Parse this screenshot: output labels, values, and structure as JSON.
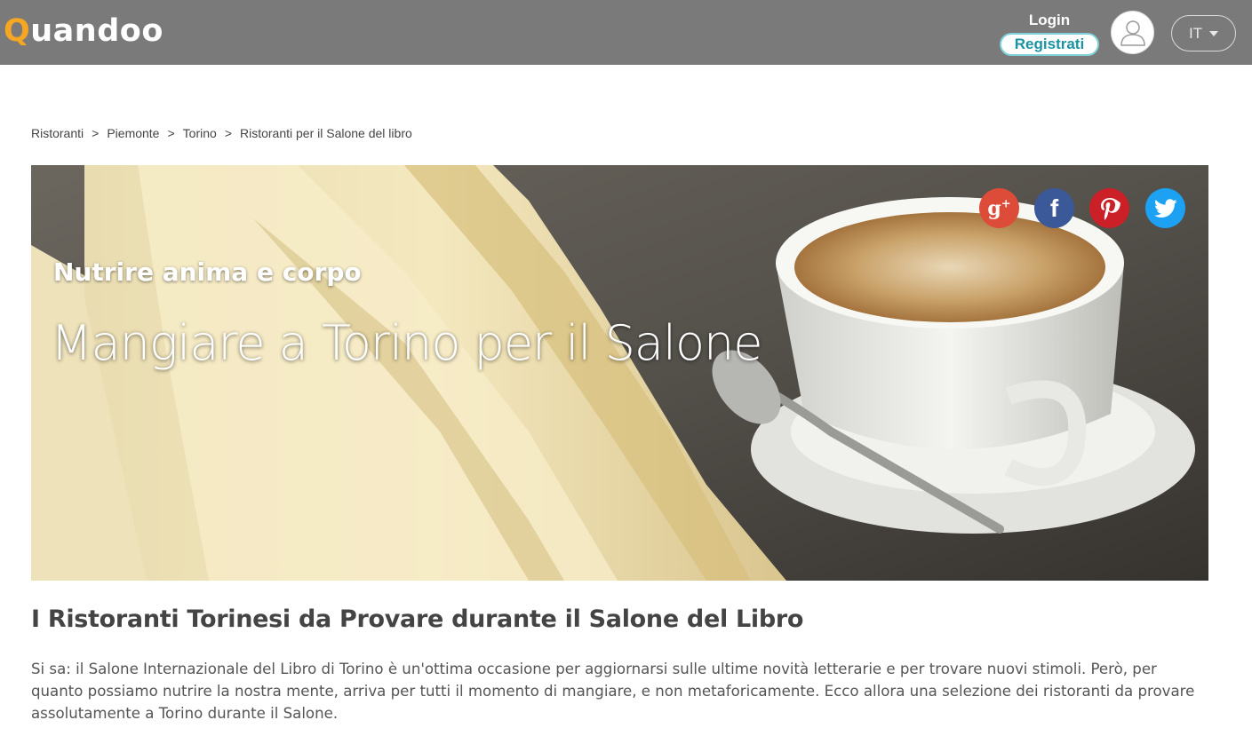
{
  "header": {
    "logo_q": "Q",
    "logo_rest": "uandoo",
    "login_label": "Login",
    "register_label": "Registrati",
    "avatar_icon": "user-icon",
    "language": "IT",
    "colors": {
      "bar": "#7a7a7a",
      "logo_accent": "#f5a623",
      "register_text": "#1a93a3"
    }
  },
  "breadcrumb": {
    "items": [
      "Ristoranti",
      "Piemonte",
      "Torino",
      "Ristoranti per il Salone del libro"
    ],
    "separator": ">"
  },
  "hero": {
    "subtitle": "Nutrire anima e corpo",
    "title": "Mangiare a Torino per il Salone",
    "social": [
      {
        "icon": "google-plus-icon",
        "color": "#dd4b39"
      },
      {
        "icon": "facebook-icon",
        "color": "#3b5998"
      },
      {
        "icon": "pinterest-icon",
        "color": "#cb2027"
      },
      {
        "icon": "twitter-icon",
        "color": "#1da1f2"
      }
    ]
  },
  "article": {
    "title": "I Ristoranti Torinesi da Provare durante il Salone del Libro",
    "body": "Si sa: il Salone Internazionale del Libro di Torino è un'ottima occasione per aggiornarsi sulle ultime novità letterarie e per trovare nuovi stimoli. Però, per quanto possiamo nutrire la nostra mente, arriva per tutti il momento di mangiare, e non metaforicamente. Ecco allora una selezione dei ristoranti da provare assolutamente a Torino durante il Salone."
  }
}
